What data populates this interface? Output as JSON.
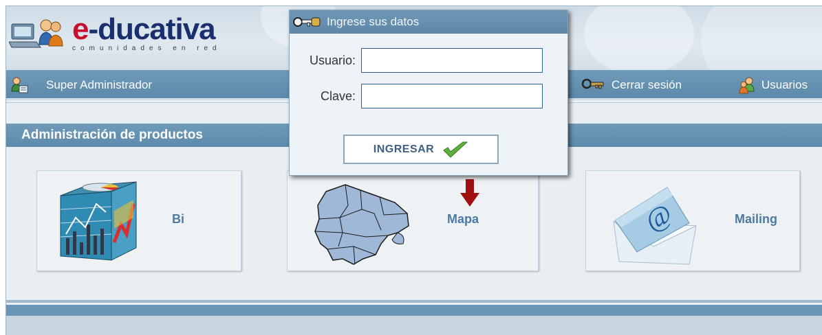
{
  "header": {
    "logo_prefix": "e",
    "logo_rest": "-ducativa",
    "logo_tagline": "comunidades en red"
  },
  "nav": {
    "user_label": "Super Administrador",
    "logout_label": "Cerrar sesión",
    "users_label": "Usuarios"
  },
  "section": {
    "title": "Administración de productos"
  },
  "products": [
    {
      "label": "Bi"
    },
    {
      "label": "Mapa"
    },
    {
      "label": "Mailing"
    }
  ],
  "login": {
    "title": "Ingrese sus datos",
    "user_label": "Usuario:",
    "user_value": "",
    "password_label": "Clave:",
    "password_value": "",
    "submit_label": "INGRESAR"
  },
  "colors": {
    "brand_red": "#c8102e",
    "brand_blue": "#1a2f6e",
    "bar_blue": "#6a96b6",
    "label_blue": "#4d7aa3",
    "arrow_red": "#a01010",
    "check_green": "#5fb03a"
  }
}
